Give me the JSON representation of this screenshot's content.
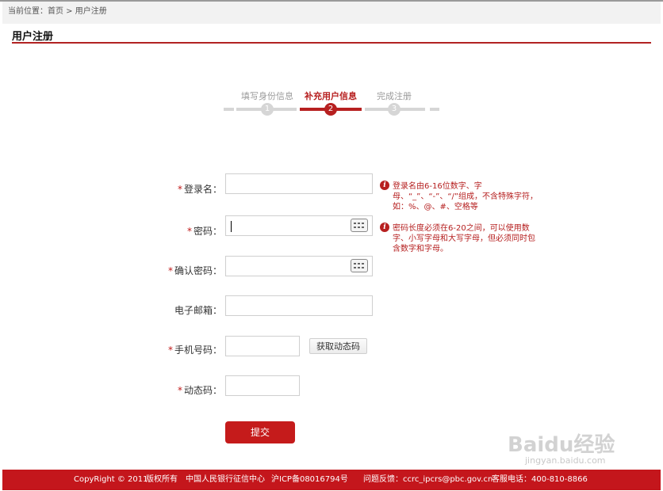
{
  "breadcrumb": "当前位置：首页 > 用户注册",
  "page_title": "用户注册",
  "steps": [
    {
      "label": "填写身份信息",
      "number": "1",
      "active": false
    },
    {
      "label": "补充用户信息",
      "number": "2",
      "active": true
    },
    {
      "label": "完成注册",
      "number": "3",
      "active": false
    }
  ],
  "required_mark": "*",
  "form": {
    "login": {
      "label": "登录名：",
      "value": ""
    },
    "password": {
      "label": "密码：",
      "value": ""
    },
    "confirm": {
      "label": "确认密码：",
      "value": ""
    },
    "email": {
      "label": "电子邮箱：",
      "value": ""
    },
    "phone": {
      "label": "手机号码：",
      "value": ""
    },
    "otp_button": "获取动态码",
    "otp": {
      "label": "动态码：",
      "value": ""
    },
    "submit": "提交"
  },
  "hints": {
    "login": "登录名由6-16位数字、字母、“_”、“-”、“/”组成，不含特殊字符，如：%、@、#、空格等",
    "password": "密码长度必须在6-20之间，可以使用数字、小写字母和大写字母，但必须同时包含数字和字母。"
  },
  "footer": {
    "copyright": "CopyRight © 2011",
    "rights": "版权所有",
    "org": "中国人民银行征信中心",
    "icp": "沪ICP备08016794号",
    "feedback": "问题反馈：ccrc_ipcrs@pbc.gov.cn",
    "hotline": "客服电话：400-810-8866"
  },
  "watermark": {
    "text": "Baidu经验",
    "url": "jingyan.baidu.com"
  },
  "colors": {
    "accent": "#b72020",
    "footer": "#c4161c"
  }
}
